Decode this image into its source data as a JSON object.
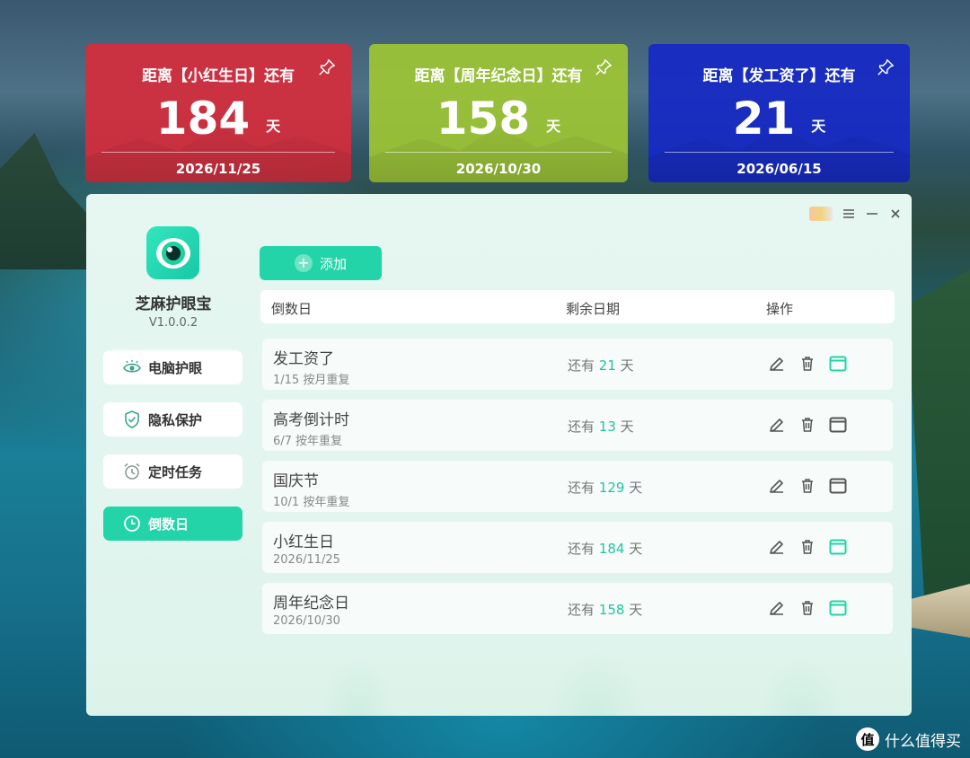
{
  "cards": [
    {
      "title": "距离【小红生日】还有",
      "days": "184",
      "unit": "天",
      "date": "2026/11/25",
      "color": "#d62c3c"
    },
    {
      "title": "距离【周年纪念日】还有",
      "days": "158",
      "unit": "天",
      "date": "2026/10/30",
      "color": "#9ec634"
    },
    {
      "title": "距离【发工资了】还有",
      "days": "21",
      "unit": "天",
      "date": "2026/06/15",
      "color": "#1628c6"
    }
  ],
  "app": {
    "name": "芝麻护眼宝",
    "version": "V1.0.0.2",
    "accent": "#22d4a8"
  },
  "nav": [
    {
      "label": "电脑护眼",
      "icon": "eye-icon"
    },
    {
      "label": "隐私保护",
      "icon": "shield-icon"
    },
    {
      "label": "定时任务",
      "icon": "alarm-icon"
    },
    {
      "label": "倒数日",
      "icon": "clock-icon",
      "active": true
    }
  ],
  "toolbar": {
    "add_label": "添加"
  },
  "table": {
    "headers": {
      "name": "倒数日",
      "remain": "剩余日期",
      "ops": "操作"
    },
    "rows": [
      {
        "title": "发工资了",
        "sub": "1/15 按月重复",
        "prefix": "还有",
        "days": "21",
        "suffix": "天",
        "display_active": true
      },
      {
        "title": "高考倒计时",
        "sub": "6/7 按年重复",
        "prefix": "还有",
        "days": "13",
        "suffix": "天",
        "display_active": false
      },
      {
        "title": "国庆节",
        "sub": "10/1 按年重复",
        "prefix": "还有",
        "days": "129",
        "suffix": "天",
        "display_active": false
      },
      {
        "title": "小红生日",
        "sub": "2026/11/25",
        "prefix": "还有",
        "days": "184",
        "suffix": "天",
        "display_active": true
      },
      {
        "title": "周年纪念日",
        "sub": "2026/10/30",
        "prefix": "还有",
        "days": "158",
        "suffix": "天",
        "display_active": true
      }
    ]
  },
  "watermark": {
    "logo": "值",
    "text": "什么值得买"
  }
}
